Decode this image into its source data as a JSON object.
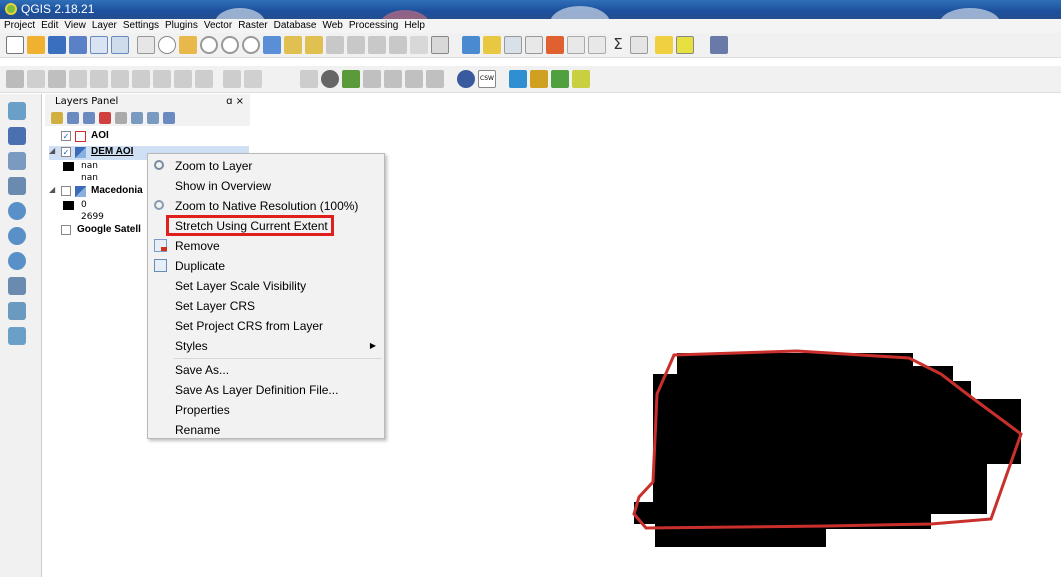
{
  "window": {
    "title": "QGIS 2.18.21"
  },
  "menubar": {
    "items": [
      "Project",
      "Edit",
      "View",
      "Layer",
      "Settings",
      "Plugins",
      "Vector",
      "Raster",
      "Database",
      "Web",
      "Processing",
      "Help"
    ]
  },
  "layers_panel": {
    "title": "Layers Panel",
    "controls": "ɑ ×",
    "layers": [
      {
        "name": "AOI",
        "checked": true
      },
      {
        "name": "DEM AOI",
        "checked": true,
        "legend": [
          "nan",
          "nan"
        ]
      },
      {
        "name": "Macedonia",
        "checked": false,
        "legend": [
          "0",
          "2699"
        ]
      },
      {
        "name": "Google Satell",
        "checked": false
      }
    ]
  },
  "context_menu": {
    "items": [
      {
        "label": "Zoom to Layer",
        "icon": "zoom-icon"
      },
      {
        "label": "Show in Overview",
        "icon": ""
      },
      {
        "label": "Zoom to Native Resolution (100%)",
        "icon": "native-resolution-icon"
      },
      {
        "label": "Stretch Using Current Extent",
        "icon": ""
      },
      {
        "label": "Remove",
        "icon": "remove-icon"
      },
      {
        "label": "Duplicate",
        "icon": "duplicate-icon"
      },
      {
        "label": "Set Layer Scale Visibility",
        "icon": ""
      },
      {
        "label": "Set Layer CRS",
        "icon": ""
      },
      {
        "label": "Set Project CRS from Layer",
        "icon": ""
      },
      {
        "label": "Styles",
        "icon": "submenu-arrow"
      },
      {
        "label": "Save As...",
        "icon": ""
      },
      {
        "label": "Save As Layer Definition File...",
        "icon": ""
      },
      {
        "label": "Properties",
        "icon": ""
      },
      {
        "label": "Rename",
        "icon": ""
      }
    ],
    "highlighted": "Stretch Using Current Extent",
    "highlight_color": "#e0201c"
  },
  "colors": {
    "titlebar": "#1c4f9c",
    "aoi_outline": "#c9302c",
    "raster_fill": "#000000"
  }
}
